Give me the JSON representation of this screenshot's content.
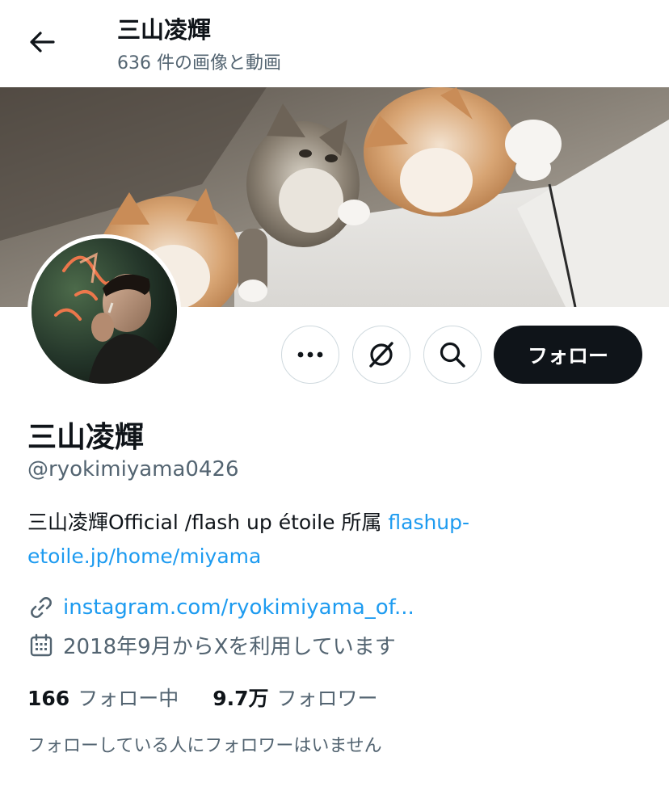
{
  "header": {
    "title": "三山凌輝",
    "subtitle": "636 件の画像と動画"
  },
  "actions": {
    "follow_label": "フォロー"
  },
  "profile": {
    "name": "三山凌輝",
    "handle": "@ryokimiyama0426",
    "bio_text": "三山凌輝Official /flash up étoile 所属 ",
    "bio_link_line1": "flashup-",
    "bio_link_line2": "etoile.jp/home/miyama",
    "website": "instagram.com/ryokimiyama_of...",
    "joined": "2018年9月からXを利用しています"
  },
  "stats": {
    "following_count": "166",
    "following_label": "フォロー中",
    "followers_count": "9.7万",
    "followers_label": "フォロワー"
  },
  "followed_by_note": "フォローしている人にフォロワーはいません",
  "icons": [
    "back-arrow-icon",
    "more-icon",
    "grok-icon",
    "search-icon",
    "link-icon",
    "calendar-icon"
  ],
  "colors": {
    "text_primary": "#0f1419",
    "text_secondary": "#536471",
    "link": "#1d9bf0",
    "follow_button_bg": "#0f1419"
  }
}
